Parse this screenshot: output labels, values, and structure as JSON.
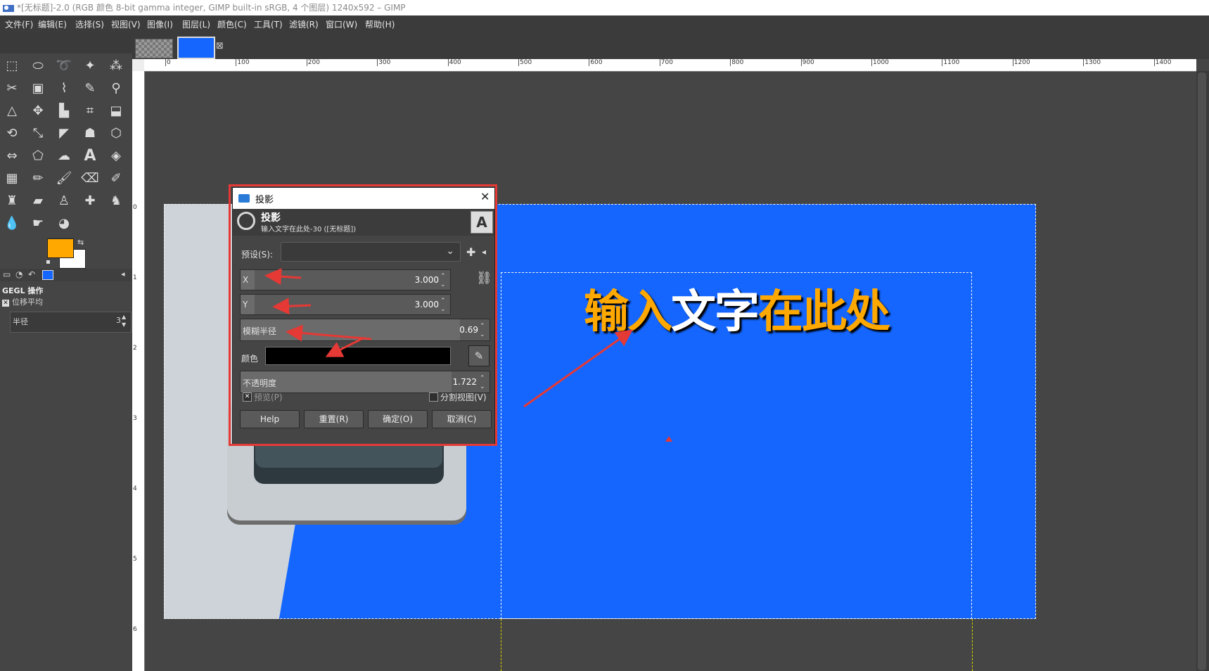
{
  "window": {
    "title": "*[无标题]-2.0 (RGB 颜色 8-bit gamma integer, GIMP built-in sRGB, 4 个图层) 1240x592 – GIMP"
  },
  "menubar": {
    "items": [
      "文件(F)",
      "编辑(E)",
      "选择(S)",
      "视图(V)",
      "图像(I)",
      "图层(L)",
      "颜色(C)",
      "工具(T)",
      "滤镜(R)",
      "窗口(W)",
      "帮助(H)"
    ]
  },
  "toolbox": {
    "fg_color": "#ffa800",
    "bg_color": "#ffffff",
    "gegl_title": "GEGL 操作",
    "gegl_sub": "位移平均",
    "radius_label": "半径",
    "radius_value": "3"
  },
  "rulers": {
    "h_labels": [
      "0",
      "100",
      "200",
      "300",
      "400",
      "500",
      "600",
      "700",
      "800",
      "900",
      "1000",
      "1100",
      "1200",
      "1300",
      "1400"
    ],
    "v_labels": [
      "0",
      "1",
      "2",
      "3",
      "4",
      "5",
      "6"
    ]
  },
  "canvas": {
    "text_part1": "输入",
    "text_part2": "文字",
    "text_part3": "在此处"
  },
  "dialog": {
    "title": "投影",
    "header_title": "投影",
    "header_sub": "输入文字在此处-30 ([无标题])",
    "preset_label": "预设(S):",
    "x_label": "X",
    "x_value": "3.000",
    "y_label": "Y",
    "y_value": "3.000",
    "blur_label": "模糊半径",
    "blur_value": "0.69",
    "color_label": "颜色",
    "shadow_color": "#000000",
    "opacity_label": "不透明度",
    "opacity_value": "1.722",
    "preview_label": "预览(P)",
    "split_label": "分割视图(V)",
    "help": "Help",
    "reset": "重置(R)",
    "ok": "确定(O)",
    "cancel": "取消(C)"
  },
  "annotation_color": "#e53935"
}
